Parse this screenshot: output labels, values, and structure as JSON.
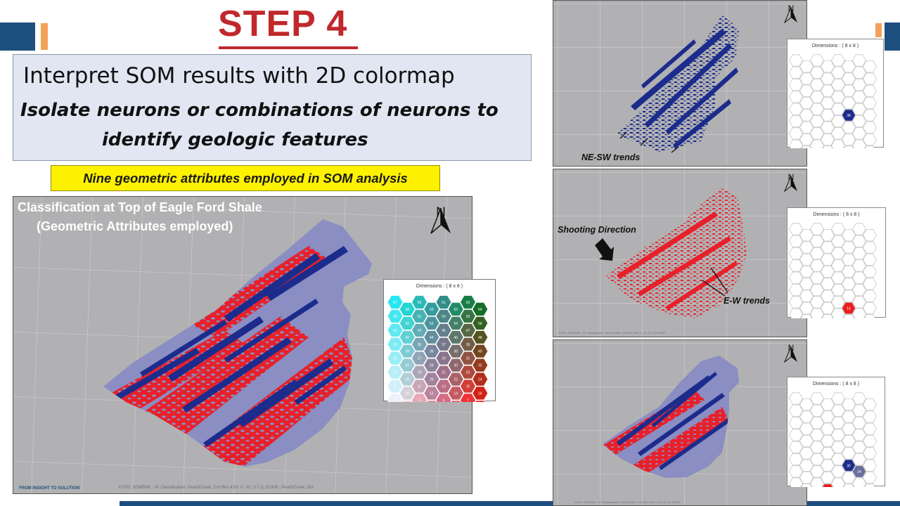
{
  "slide": {
    "step_title": "STEP 4",
    "heading": "Interpret SOM results with 2D colormap",
    "subheading_line1": "Isolate neurons or combinations of neurons to",
    "subheading_line2": "identify geologic features",
    "yellow_note": "Nine geometric attributes employed in SOM analysis"
  },
  "main_map": {
    "caption_line1": "Classification at Top of Eagle Ford Shale",
    "caption_line2": "(Geometric Attributes employed)",
    "north_label": "N",
    "footer": "EUFD, SOMRAK - M: Classification, PeachCreek, Crd Res 4.83 +/- 10, (17.1) 15:008 - PeachCreek, Oct",
    "colormap_title": "Dimensions :  ( 8 x 8 )",
    "colormap_neurons": [
      "57",
      "58",
      "59",
      "60",
      "61",
      "62",
      "63",
      "64",
      "49",
      "50",
      "51",
      "52",
      "53",
      "54",
      "55",
      "56",
      "41",
      "42",
      "43",
      "44",
      "45",
      "46",
      "47",
      "48",
      "33",
      "34",
      "35",
      "36",
      "37",
      "38",
      "39",
      "40",
      "25",
      "26",
      "27",
      "28",
      "29",
      "30",
      "31",
      "32",
      "17",
      "18",
      "19",
      "20",
      "21",
      "22",
      "23",
      "24",
      "9",
      "10",
      "11",
      "12",
      "13",
      "14",
      "15",
      "16",
      "1",
      "2",
      "3",
      "4",
      "5",
      "6",
      "7",
      "8"
    ]
  },
  "right_panels": [
    {
      "north_label": "N",
      "annotation": "NE-SW trends",
      "hex_title": "Dimensions :  ( 8 x 8 )",
      "highlight_label": "38",
      "highlight_color": "#1c2c8c"
    },
    {
      "north_label": "N",
      "annotation_direction": "Shooting Direction",
      "annotation": "E-W trends",
      "hex_title": "Dimensions :  ( 8 x 8 )",
      "highlight_label": "14",
      "highlight_color": "#ee1c1c",
      "footer": "EUFD, SOMRAK - M: Classification, PeachCreek, Crd Res 4.83 +/- 10, (17.1) 15:008"
    },
    {
      "north_label": "N",
      "hex_title": "Dimensions :  ( 8 x 8 )",
      "highlights": [
        {
          "label": "30",
          "color": "#1c2c8c"
        },
        {
          "label": "24",
          "color": "#6a6e9e"
        },
        {
          "label": "14",
          "color": "#ee1c1c"
        }
      ],
      "footer": "EUFD, SOMRAK - M: Classification, PeachCreek, Crd Res 4.83 +/- 10, (17.1) 15:008"
    }
  ],
  "logo_text": "FROM INSIGHT TO SOLUTION",
  "colors": {
    "accent_red": "#c0282c",
    "brand_blue": "#1d4f7e",
    "brand_orange": "#f2a15b",
    "highlight_yellow": "#fff200",
    "map_gray": "#b1b1b3",
    "som_red": "#e8202a",
    "som_blue": "#1c2c8c",
    "som_lavender": "#8a8ec2"
  }
}
